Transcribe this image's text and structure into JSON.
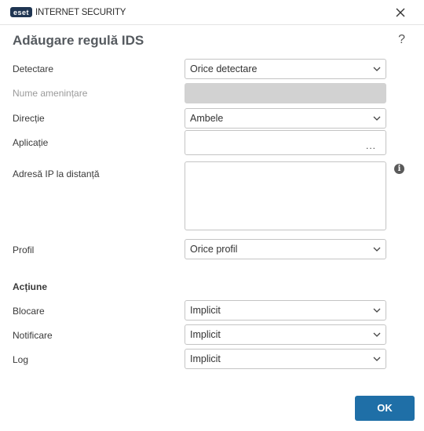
{
  "titlebar": {
    "logo_badge": "eset",
    "product": "INTERNET SECURITY"
  },
  "dialog": {
    "title": "Adăugare regulă IDS",
    "help": "?"
  },
  "form": {
    "detection_label": "Detectare",
    "detection_value": "Orice detectare",
    "threat_name_label": "Nume amenințare",
    "threat_name_value": "",
    "direction_label": "Direcție",
    "direction_value": "Ambele",
    "application_label": "Aplicație",
    "application_value": "",
    "application_browse": "...",
    "remote_ip_label": "Adresă IP la distanță",
    "remote_ip_value": "",
    "profile_label": "Profil",
    "profile_value": "Orice profil"
  },
  "actions": {
    "section_label": "Acțiune",
    "block_label": "Blocare",
    "block_value": "Implicit",
    "notify_label": "Notificare",
    "notify_value": "Implicit",
    "log_label": "Log",
    "log_value": "Implicit"
  },
  "footer": {
    "ok_label": "OK"
  },
  "colors": {
    "accent": "#1f6fa7",
    "logo": "#1f3552",
    "disabled_field": "#d2d2d2"
  },
  "icons": [
    "close-icon",
    "help-icon",
    "chevron-down-icon",
    "info-icon"
  ]
}
